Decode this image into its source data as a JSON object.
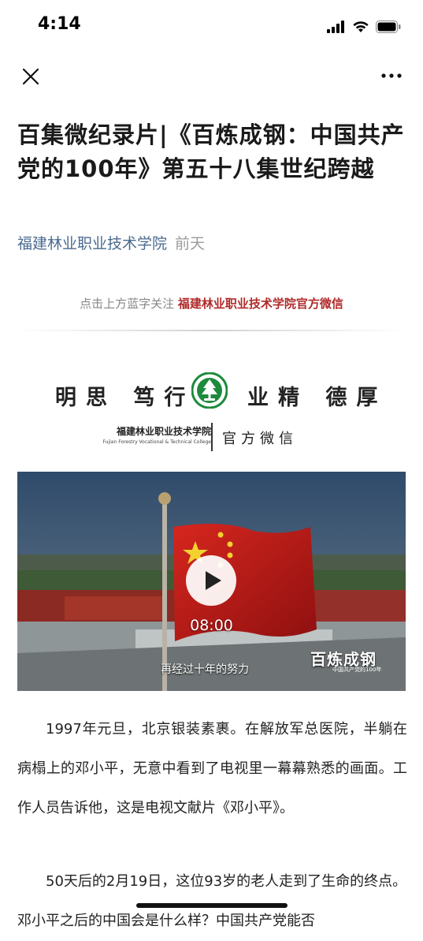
{
  "status_bar": {
    "time": "4:14"
  },
  "nav": {
    "close_icon": "close-icon",
    "more_icon": "more-icon"
  },
  "article": {
    "title": "百集微纪录片|《百炼成钢：中国共产党的100年》第五十八集世纪跨越",
    "author": "福建林业职业技术学院",
    "date": "前天"
  },
  "follow": {
    "prefix": "点击上方蓝字关注",
    "account": "福建林业职业技术学院官方微信"
  },
  "banner": {
    "motto_left": "明思 笃行",
    "motto_right": "业精 德厚",
    "school_cn": "福建林业职业技术学院",
    "school_en": "Fujian Forestry Vocational & Technical College",
    "official": "官方微信"
  },
  "video": {
    "duration": "08:00",
    "subtitle": "再经过十年的努力",
    "watermark_title": "百炼成钢",
    "watermark_sub": "中国共产党的100年"
  },
  "body": {
    "para1": "1997年元旦，北京银装素裹。在解放军总医院，半躺在病榻上的邓小平，无意中看到了电视里一幕幕熟悉的画面。工作人员告诉他，这是电视文献片《邓小平》。",
    "para2": "50天后的2月19日，这位93岁的老人走到了生命的终点。邓小平之后的中国会是什么样？中国共产党能否"
  },
  "colors": {
    "author": "#4a6a8f",
    "follow_account": "#b02a2a",
    "flag_red": "#c41a1a"
  }
}
